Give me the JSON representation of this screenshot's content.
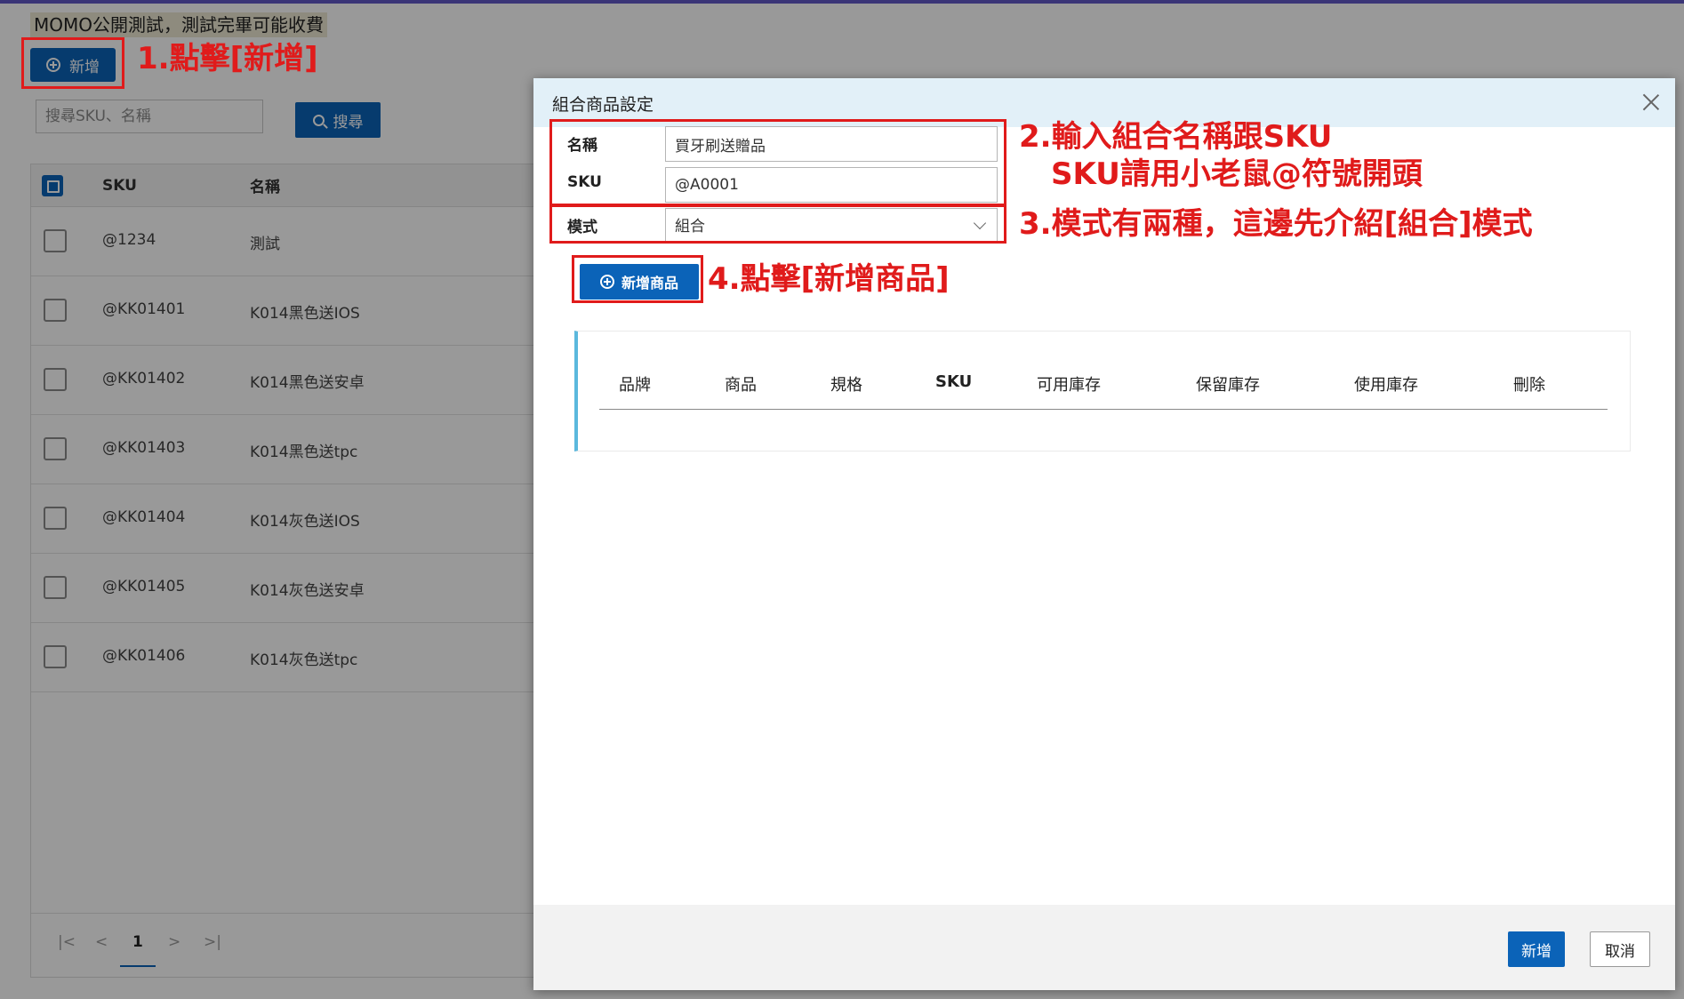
{
  "notice": "MOMO公開測試，測試完畢可能收費",
  "toolbar": {
    "add_label": "新增"
  },
  "search": {
    "placeholder": "搜尋SKU、名稱",
    "button_label": "搜尋"
  },
  "list": {
    "columns": {
      "sku": "SKU",
      "name": "名稱"
    },
    "rows": [
      {
        "sku": "@1234",
        "name": "測試"
      },
      {
        "sku": "@KK01401",
        "name": "K014黑色送IOS"
      },
      {
        "sku": "@KK01402",
        "name": "K014黑色送安卓"
      },
      {
        "sku": "@KK01403",
        "name": "K014黑色送tpc"
      },
      {
        "sku": "@KK01404",
        "name": "K014灰色送IOS"
      },
      {
        "sku": "@KK01405",
        "name": "K014灰色送安卓"
      },
      {
        "sku": "@KK01406",
        "name": "K014灰色送tpc"
      }
    ]
  },
  "pagination": {
    "first": "|<",
    "prev": "<",
    "current": "1",
    "next": ">",
    "last": ">|"
  },
  "dialog": {
    "title": "組合商品設定",
    "fields": {
      "name_label": "名稱",
      "name_value": "買牙刷送贈品",
      "sku_label": "SKU",
      "sku_value": "@A0001",
      "mode_label": "模式",
      "mode_value": "組合"
    },
    "add_product_label": "新增商品",
    "table_headers": [
      "品牌",
      "商品",
      "規格",
      "SKU",
      "可用庫存",
      "保留庫存",
      "使用庫存",
      "刪除"
    ],
    "ok_label": "新增",
    "cancel_label": "取消"
  },
  "annotations": {
    "step1": "1.點擊[新增]",
    "step2_line1": "2.輸入組合名稱跟SKU",
    "step2_line2": "SKU請用小老鼠@符號開頭",
    "step3": "3.模式有兩種，這邊先介紹[組合]模式",
    "step4": "4.點擊[新增商品]"
  },
  "colors": {
    "primary": "#0b63b8",
    "annotation_red": "#e01b1b",
    "dialog_header": "#e2f0f8",
    "table_accent": "#5bb8dd"
  }
}
